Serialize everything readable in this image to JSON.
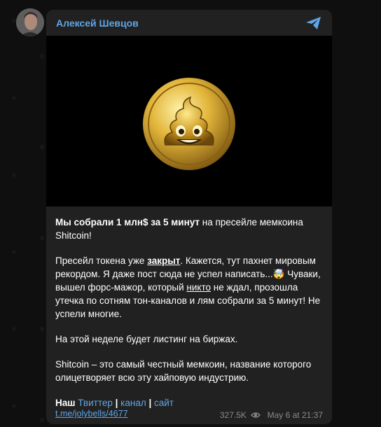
{
  "post": {
    "author": "Алексей Шевцов",
    "heading_bold": "Мы собрали 1 млн$ за 5 минут",
    "heading_rest": " на пресейле мемкоина Shitcoin!",
    "p2_a": "Пресейл токена уже ",
    "p2_closed": "закрыт",
    "p2_b": ". Кажется, тут пахнет мировым рекордом. Я даже пост сюда не успел написать...",
    "p2_emoji": "🤯",
    "p2_c": " Чуваки, вышел форс-мажор, который ",
    "p2_nobody": "никто",
    "p2_d": " не ждал, прозошла утечка по сотням тон-каналов и лям собрали за 5 минут! Не успели многие.",
    "p3": "На этой неделе будет листинг на биржах.",
    "p4": "Shitcoin – это самый честный мемкоин, название которого олицетворяет всю эту хайповую индустрию.",
    "links_prefix": "Наш ",
    "link_twitter": "Твиттер",
    "separator": " | ",
    "link_channel": "канал",
    "link_site": "сайт",
    "post_link": "t.me/jolybells/4677",
    "views": "327.5K",
    "date": "May 6 at 21:37"
  },
  "icons": {
    "share": "share-icon",
    "views": "eye-icon",
    "coin": "poop-coin-image"
  },
  "colors": {
    "background": "#0f0f0f",
    "card": "#212121",
    "accent": "#5fa6e6",
    "meta": "#8a8a8a"
  }
}
